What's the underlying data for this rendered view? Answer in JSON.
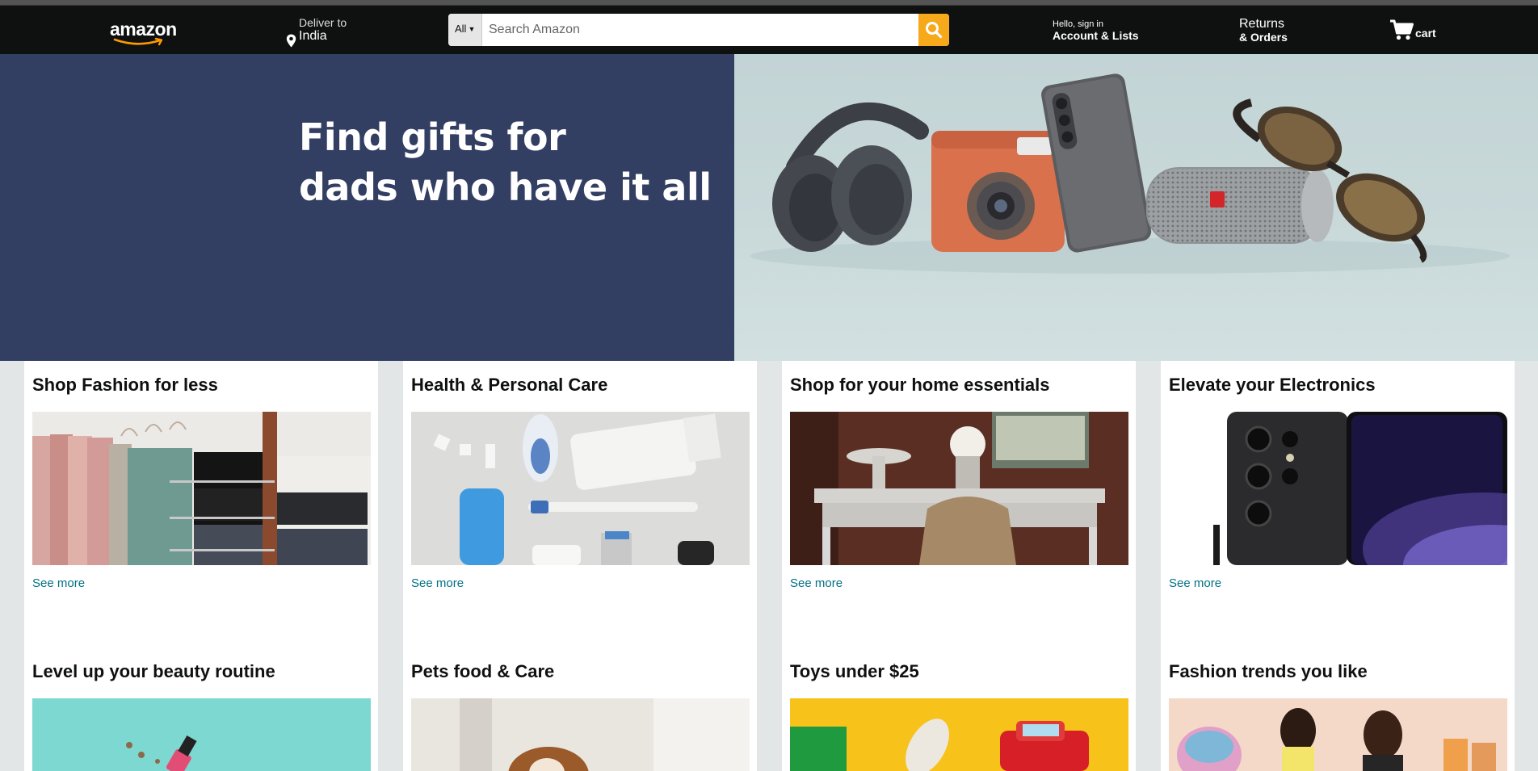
{
  "nav": {
    "logo_text": "amazon",
    "deliver_to_label": "Deliver to",
    "deliver_to_country": "India",
    "search_category": "All",
    "search_placeholder": "Search Amazon",
    "account_greeting": "Hello, sign in",
    "account_label": "Account & Lists",
    "returns_label": "Returns",
    "orders_label": "& Orders",
    "cart_label": "cart"
  },
  "hero": {
    "title_line1": "Find gifts for",
    "title_line2": "dads who have it all"
  },
  "cards": [
    {
      "title": "Shop Fashion for less",
      "link": "See more"
    },
    {
      "title": "Health & Personal Care",
      "link": "See more"
    },
    {
      "title": "Shop for your home essentials",
      "link": "See more"
    },
    {
      "title": "Elevate your Electronics",
      "link": "See more"
    },
    {
      "title": "Level up your beauty routine"
    },
    {
      "title": "Pets food & Care"
    },
    {
      "title": "Toys under $25"
    },
    {
      "title": "Fashion trends you like"
    }
  ],
  "colors": {
    "nav_bg": "#0f1111",
    "search_button": "#febd69",
    "hero_left_bg": "#333e63",
    "link": "#007185",
    "page_bg": "#e3e6e6"
  },
  "icons": {
    "search": "magnifier-icon",
    "location": "map-pin-icon",
    "cart": "shopping-cart-icon",
    "category_dropdown": "chevron-down-icon"
  }
}
